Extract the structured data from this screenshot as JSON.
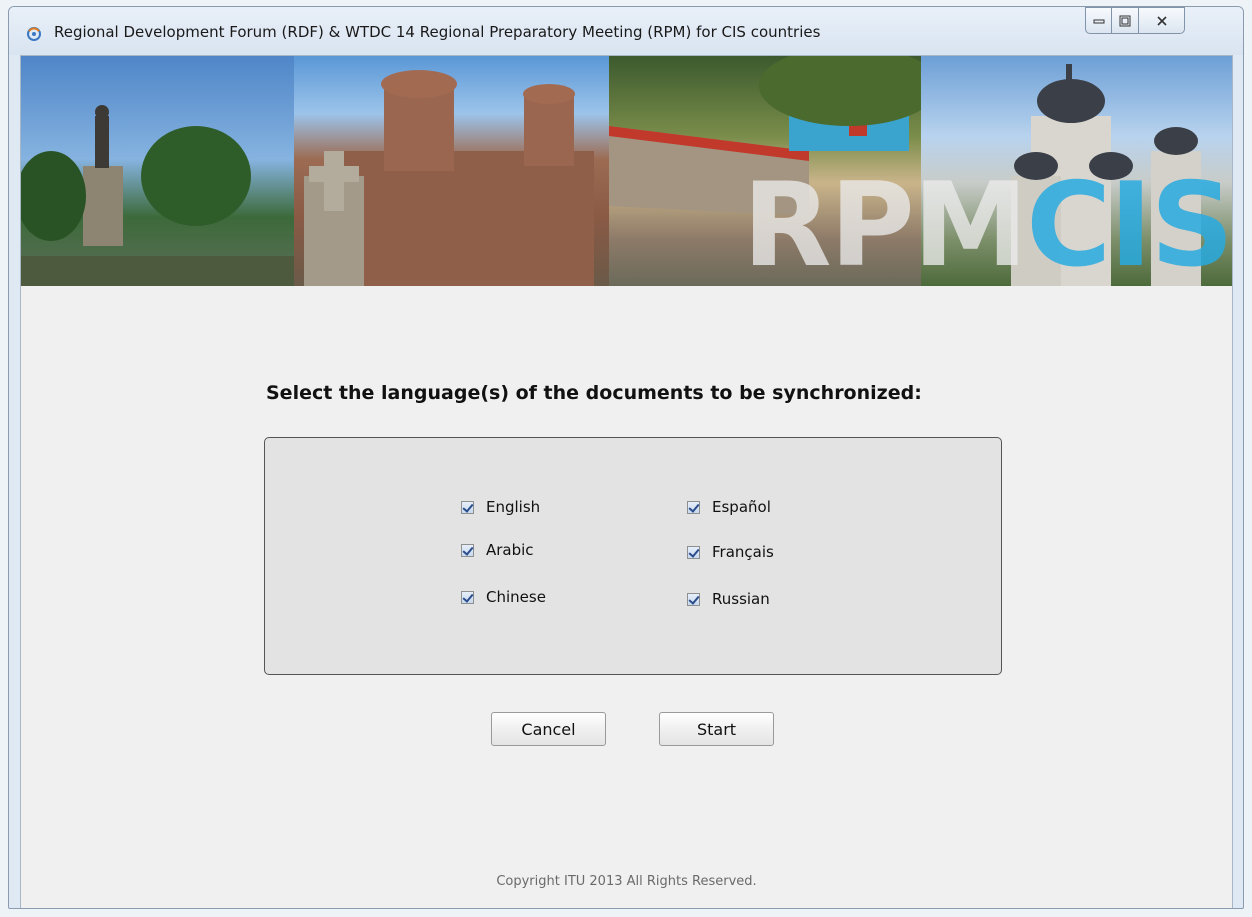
{
  "window": {
    "title": "Regional Development Forum (RDF) & WTDC 14 Regional Preparatory Meeting (RPM) for CIS countries",
    "controls": {
      "minimize": "minimize-icon",
      "maximize": "maximize-icon",
      "close": "close-icon"
    }
  },
  "banner": {
    "logo_part1": "RPM",
    "logo_part2": "CIS",
    "logo_color": "#28aae1"
  },
  "main": {
    "heading": "Select the language(s) of the documents to be synchronized:"
  },
  "languages": [
    {
      "label": "English",
      "checked": true
    },
    {
      "label": "Arabic",
      "checked": true
    },
    {
      "label": "Chinese",
      "checked": true
    },
    {
      "label": "Español",
      "checked": true
    },
    {
      "label": "Français",
      "checked": true
    },
    {
      "label": "Russian",
      "checked": true
    }
  ],
  "buttons": {
    "cancel": "Cancel",
    "start": "Start"
  },
  "footer": "Copyright ITU 2013 All Rights Reserved."
}
